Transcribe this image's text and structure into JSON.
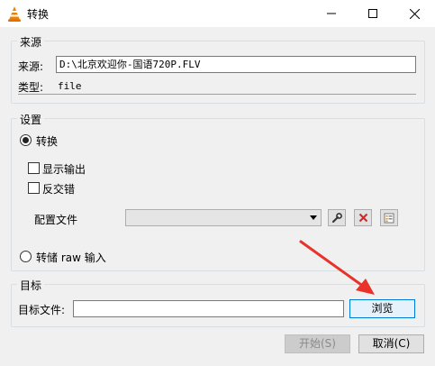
{
  "window": {
    "title": "转换",
    "minimize_glyph": "—",
    "maximize_glyph": "☐",
    "close_glyph": "✕"
  },
  "source": {
    "legend": "来源",
    "source_label": "来源:",
    "source_value": "D:\\北京欢迎你-国语720P.FLV",
    "type_label": "类型:",
    "type_value": "file"
  },
  "settings": {
    "legend": "设置",
    "convert_label": "转换",
    "show_output_label": "显示输出",
    "deinterlace_label": "反交错",
    "profile_label": "配置文件",
    "profile_value": "",
    "dump_raw_label": "转储 raw 输入"
  },
  "target": {
    "legend": "目标",
    "file_label": "目标文件:",
    "file_value": "",
    "browse_label": "浏览"
  },
  "footer": {
    "start_label": "开始(S)",
    "cancel_label": "取消(C)"
  },
  "colors": {
    "annotation_arrow": "#e8322a",
    "delete_icon": "#d42a2a"
  },
  "icons": {
    "app": "vlc-cone-icon",
    "edit_profile": "wrench-icon",
    "delete_profile": "delete-x-icon",
    "new_profile": "new-profile-icon"
  }
}
